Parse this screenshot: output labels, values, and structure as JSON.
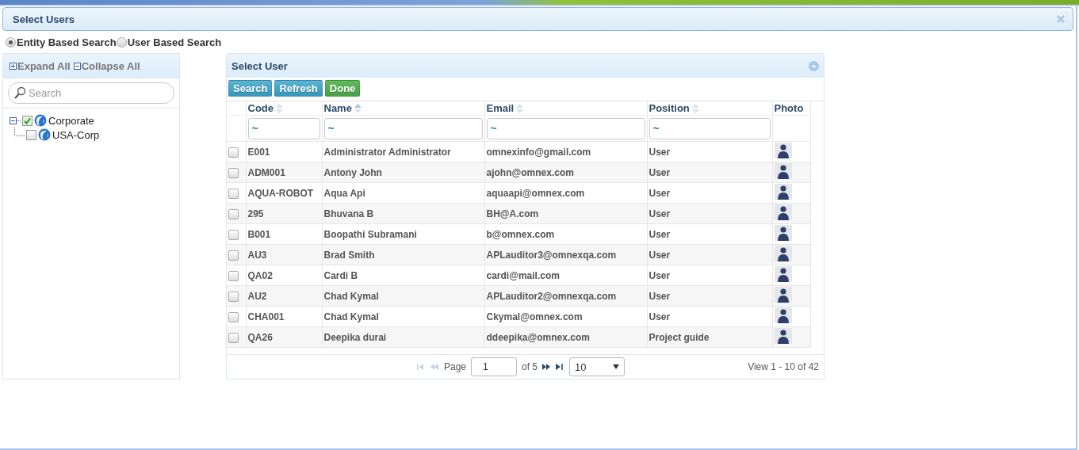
{
  "dialog": {
    "title": "Select Users"
  },
  "search_modes": [
    {
      "label": "Entity Based Search",
      "selected": true
    },
    {
      "label": "User Based Search",
      "selected": false
    }
  ],
  "tree_panel": {
    "expand_all": "Expand All",
    "collapse_all": "Collapse All",
    "search": {
      "placeholder": "Search"
    },
    "nodes": [
      {
        "label": "Corporate",
        "checked": true,
        "expanded": true,
        "children": [
          {
            "label": "USA-Corp",
            "checked": false
          }
        ]
      }
    ]
  },
  "grid": {
    "title": "Select User",
    "buttons": [
      {
        "label": "Search",
        "kind": "primary"
      },
      {
        "label": "Refresh",
        "kind": "primary"
      },
      {
        "label": "Done",
        "kind": "success"
      }
    ],
    "columns": [
      {
        "label": "Code",
        "sorted": false,
        "filter": "~"
      },
      {
        "label": "Name",
        "sorted": true,
        "filter": "~"
      },
      {
        "label": "Email",
        "sorted": false,
        "filter": "~"
      },
      {
        "label": "Position",
        "sorted": false,
        "filter": "~"
      },
      {
        "label": "Photo"
      }
    ],
    "rows": [
      {
        "checked": false,
        "code": "E001",
        "name": "Administrator Administrator",
        "email": "omnexinfo@gmail.com",
        "position": "User"
      },
      {
        "checked": false,
        "code": "ADM001",
        "name": "Antony John",
        "email": "ajohn@omnex.com",
        "position": "User"
      },
      {
        "checked": false,
        "code": "AQUA-ROBOT",
        "name": "Aqua Api",
        "email": "aquaapi@omnex.com",
        "position": "User"
      },
      {
        "checked": false,
        "code": "295",
        "name": "Bhuvana  B",
        "email": "BH@A.com",
        "position": "User"
      },
      {
        "checked": false,
        "code": "B001",
        "name": "Boopathi Subramani",
        "email": "b@omnex.com",
        "position": "User"
      },
      {
        "checked": false,
        "code": "AU3",
        "name": "Brad Smith",
        "email": "APLauditor3@omnexqa.com",
        "position": "User"
      },
      {
        "checked": false,
        "code": "QA02",
        "name": "Cardi  B",
        "email": "cardi@mail.com",
        "position": "User"
      },
      {
        "checked": false,
        "code": "AU2",
        "name": "Chad Kymal",
        "email": "APLauditor2@omnexqa.com",
        "position": "User"
      },
      {
        "checked": false,
        "code": "CHA001",
        "name": "Chad Kymal",
        "email": "Ckymal@omnex.com",
        "position": "User"
      },
      {
        "checked": false,
        "code": "QA26",
        "name": "Deepika durai",
        "email": "ddeepika@omnex.com",
        "position": "Project guide"
      }
    ],
    "pager": {
      "page_label": "Page",
      "page": "1",
      "of": "of 5",
      "page_size": "10",
      "view": "View 1 - 10 of 42"
    }
  }
}
